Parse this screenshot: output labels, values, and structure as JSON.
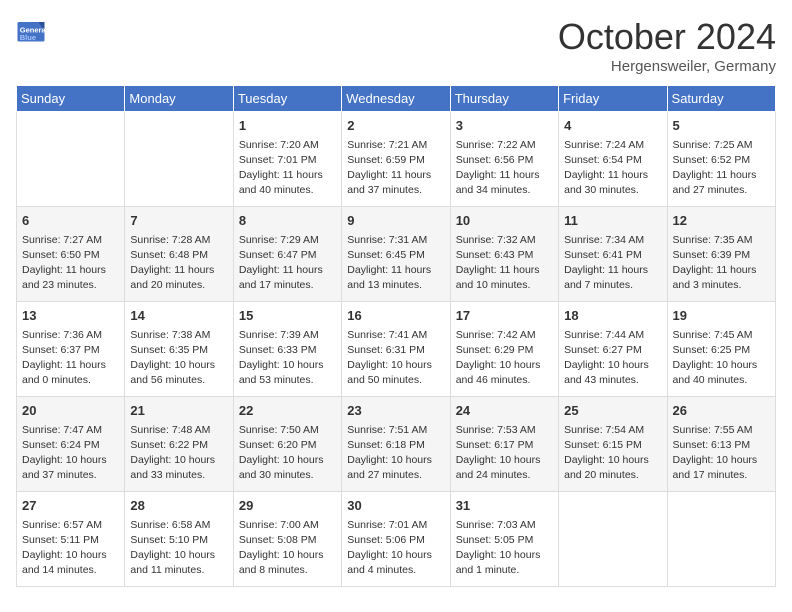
{
  "header": {
    "logo_general": "General",
    "logo_blue": "Blue",
    "month": "October 2024",
    "location": "Hergensweiler, Germany"
  },
  "weekdays": [
    "Sunday",
    "Monday",
    "Tuesday",
    "Wednesday",
    "Thursday",
    "Friday",
    "Saturday"
  ],
  "weeks": [
    [
      {
        "day": null,
        "info": null
      },
      {
        "day": null,
        "info": null
      },
      {
        "day": "1",
        "info": "Sunrise: 7:20 AM\nSunset: 7:01 PM\nDaylight: 11 hours and 40 minutes."
      },
      {
        "day": "2",
        "info": "Sunrise: 7:21 AM\nSunset: 6:59 PM\nDaylight: 11 hours and 37 minutes."
      },
      {
        "day": "3",
        "info": "Sunrise: 7:22 AM\nSunset: 6:56 PM\nDaylight: 11 hours and 34 minutes."
      },
      {
        "day": "4",
        "info": "Sunrise: 7:24 AM\nSunset: 6:54 PM\nDaylight: 11 hours and 30 minutes."
      },
      {
        "day": "5",
        "info": "Sunrise: 7:25 AM\nSunset: 6:52 PM\nDaylight: 11 hours and 27 minutes."
      }
    ],
    [
      {
        "day": "6",
        "info": "Sunrise: 7:27 AM\nSunset: 6:50 PM\nDaylight: 11 hours and 23 minutes."
      },
      {
        "day": "7",
        "info": "Sunrise: 7:28 AM\nSunset: 6:48 PM\nDaylight: 11 hours and 20 minutes."
      },
      {
        "day": "8",
        "info": "Sunrise: 7:29 AM\nSunset: 6:47 PM\nDaylight: 11 hours and 17 minutes."
      },
      {
        "day": "9",
        "info": "Sunrise: 7:31 AM\nSunset: 6:45 PM\nDaylight: 11 hours and 13 minutes."
      },
      {
        "day": "10",
        "info": "Sunrise: 7:32 AM\nSunset: 6:43 PM\nDaylight: 11 hours and 10 minutes."
      },
      {
        "day": "11",
        "info": "Sunrise: 7:34 AM\nSunset: 6:41 PM\nDaylight: 11 hours and 7 minutes."
      },
      {
        "day": "12",
        "info": "Sunrise: 7:35 AM\nSunset: 6:39 PM\nDaylight: 11 hours and 3 minutes."
      }
    ],
    [
      {
        "day": "13",
        "info": "Sunrise: 7:36 AM\nSunset: 6:37 PM\nDaylight: 11 hours and 0 minutes."
      },
      {
        "day": "14",
        "info": "Sunrise: 7:38 AM\nSunset: 6:35 PM\nDaylight: 10 hours and 56 minutes."
      },
      {
        "day": "15",
        "info": "Sunrise: 7:39 AM\nSunset: 6:33 PM\nDaylight: 10 hours and 53 minutes."
      },
      {
        "day": "16",
        "info": "Sunrise: 7:41 AM\nSunset: 6:31 PM\nDaylight: 10 hours and 50 minutes."
      },
      {
        "day": "17",
        "info": "Sunrise: 7:42 AM\nSunset: 6:29 PM\nDaylight: 10 hours and 46 minutes."
      },
      {
        "day": "18",
        "info": "Sunrise: 7:44 AM\nSunset: 6:27 PM\nDaylight: 10 hours and 43 minutes."
      },
      {
        "day": "19",
        "info": "Sunrise: 7:45 AM\nSunset: 6:25 PM\nDaylight: 10 hours and 40 minutes."
      }
    ],
    [
      {
        "day": "20",
        "info": "Sunrise: 7:47 AM\nSunset: 6:24 PM\nDaylight: 10 hours and 37 minutes."
      },
      {
        "day": "21",
        "info": "Sunrise: 7:48 AM\nSunset: 6:22 PM\nDaylight: 10 hours and 33 minutes."
      },
      {
        "day": "22",
        "info": "Sunrise: 7:50 AM\nSunset: 6:20 PM\nDaylight: 10 hours and 30 minutes."
      },
      {
        "day": "23",
        "info": "Sunrise: 7:51 AM\nSunset: 6:18 PM\nDaylight: 10 hours and 27 minutes."
      },
      {
        "day": "24",
        "info": "Sunrise: 7:53 AM\nSunset: 6:17 PM\nDaylight: 10 hours and 24 minutes."
      },
      {
        "day": "25",
        "info": "Sunrise: 7:54 AM\nSunset: 6:15 PM\nDaylight: 10 hours and 20 minutes."
      },
      {
        "day": "26",
        "info": "Sunrise: 7:55 AM\nSunset: 6:13 PM\nDaylight: 10 hours and 17 minutes."
      }
    ],
    [
      {
        "day": "27",
        "info": "Sunrise: 6:57 AM\nSunset: 5:11 PM\nDaylight: 10 hours and 14 minutes."
      },
      {
        "day": "28",
        "info": "Sunrise: 6:58 AM\nSunset: 5:10 PM\nDaylight: 10 hours and 11 minutes."
      },
      {
        "day": "29",
        "info": "Sunrise: 7:00 AM\nSunset: 5:08 PM\nDaylight: 10 hours and 8 minutes."
      },
      {
        "day": "30",
        "info": "Sunrise: 7:01 AM\nSunset: 5:06 PM\nDaylight: 10 hours and 4 minutes."
      },
      {
        "day": "31",
        "info": "Sunrise: 7:03 AM\nSunset: 5:05 PM\nDaylight: 10 hours and 1 minute."
      },
      {
        "day": null,
        "info": null
      },
      {
        "day": null,
        "info": null
      }
    ]
  ]
}
